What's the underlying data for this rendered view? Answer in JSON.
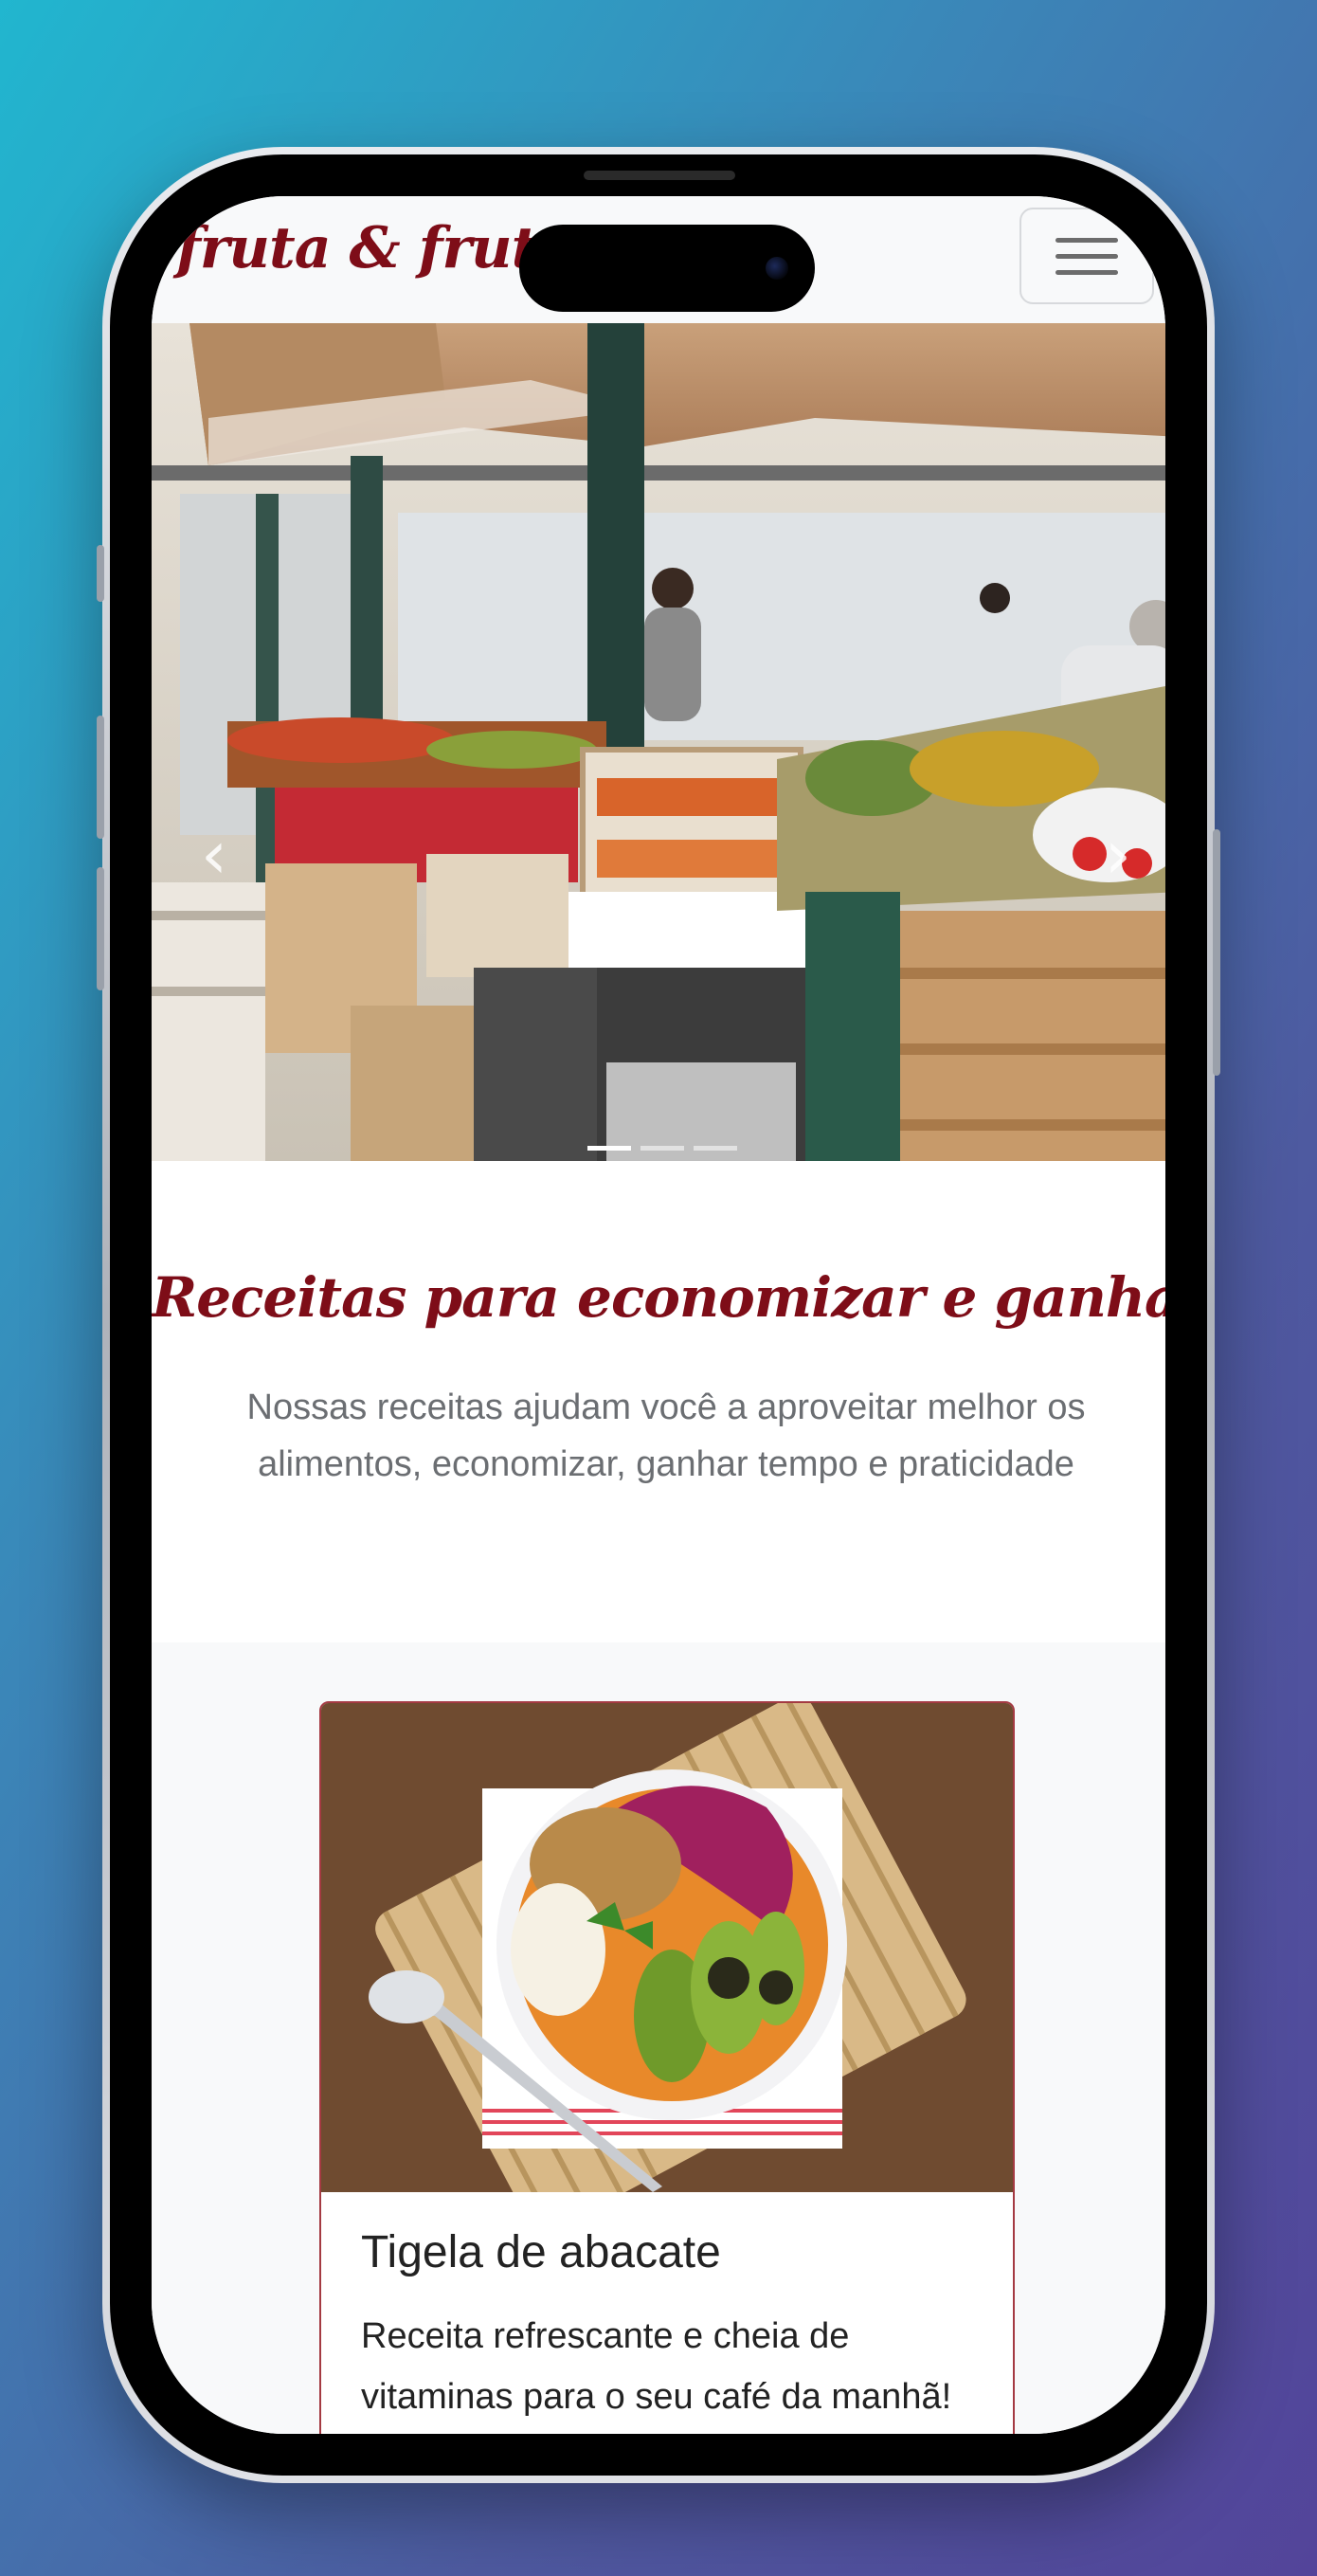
{
  "navbar": {
    "brand": "fruta & fruto",
    "toggler_icon": "hamburger-menu-icon"
  },
  "carousel": {
    "image_description_icon": "market-photo",
    "prev_icon": "chevron-left-icon",
    "next_icon": "chevron-right-icon",
    "prev_glyph": "‹",
    "next_glyph": "›",
    "slides": 3,
    "active_slide": 1
  },
  "intro": {
    "title": "Receitas para economizar e ganhar saúde",
    "text": "Nossas receitas ajudam você a aproveitar melhor os alimentos, economizar, ganhar tempo e praticidade"
  },
  "cards": [
    {
      "title": "Tigela de abacate",
      "text": "Receita refrescante e cheia de vitaminas para o seu café da manhã!"
    }
  ],
  "colors": {
    "brand": "#7e0d18",
    "card_border": "#a43a42",
    "background_gradient_start": "#21b6cf",
    "background_gradient_end": "#53449a"
  }
}
